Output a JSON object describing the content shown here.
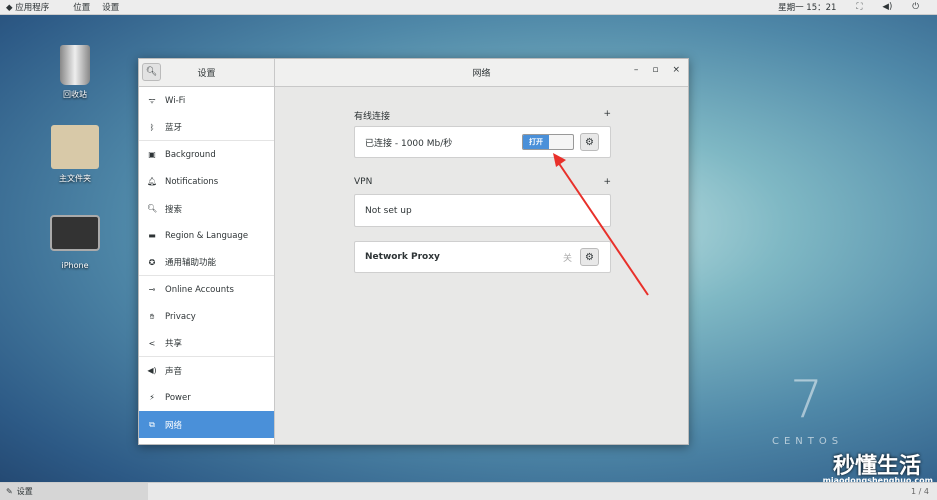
{
  "topbar": {
    "apps": "应用程序",
    "places": "位置",
    "settings": "设置",
    "clock": "星期一 15：21"
  },
  "desktop": [
    {
      "label": "回收站",
      "icon": "trash-icon"
    },
    {
      "label": "主文件夹",
      "icon": "folder-home-icon"
    },
    {
      "label": "iPhone",
      "icon": "camera-icon"
    }
  ],
  "window": {
    "sidebar_title": "设置",
    "title": "网络",
    "sidebar": [
      {
        "label": "Wi-Fi",
        "icon": "wifi-icon"
      },
      {
        "label": "蓝牙",
        "icon": "bluetooth-icon"
      },
      {
        "label": "Background",
        "icon": "background-icon"
      },
      {
        "label": "Notifications",
        "icon": "bell-icon"
      },
      {
        "label": "搜索",
        "icon": "search-icon"
      },
      {
        "label": "Region & Language",
        "icon": "keyboard-icon"
      },
      {
        "label": "通用辅助功能",
        "icon": "accessibility-icon"
      },
      {
        "label": "Online Accounts",
        "icon": "accounts-icon"
      },
      {
        "label": "Privacy",
        "icon": "privacy-icon"
      },
      {
        "label": "共享",
        "icon": "share-icon"
      },
      {
        "label": "声音",
        "icon": "speaker-icon"
      },
      {
        "label": "Power",
        "icon": "power-icon"
      },
      {
        "label": "网络",
        "icon": "network-icon",
        "selected": true
      }
    ],
    "wired": {
      "header": "有线连接",
      "status": "已连接 - 1000 Mb/秒",
      "toggle": "打开",
      "toggle_on": true
    },
    "vpn": {
      "header": "VPN",
      "status": "Not set up"
    },
    "proxy": {
      "label": "Network Proxy",
      "state": "关"
    }
  },
  "taskbar": {
    "item": "设置",
    "pager": "1 / 4"
  },
  "watermark": {
    "text": "秒懂生活",
    "url": "miaodongshenghuo.com"
  },
  "wallpaper": {
    "brand": "CENTOS",
    "number": "7"
  },
  "colors": {
    "accent": "#4a90d9",
    "arrow": "#e8302a"
  }
}
